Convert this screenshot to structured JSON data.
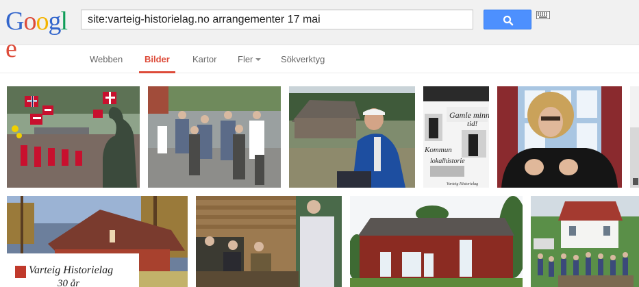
{
  "logo": {
    "letters": [
      "G",
      "o",
      "o",
      "g",
      "l",
      "e"
    ],
    "colors": [
      "#3366cc",
      "#dd4b39",
      "#f4b400",
      "#3366cc",
      "#0f9d58",
      "#dd4b39"
    ]
  },
  "search": {
    "query": "site:varteig-historielag.no arrangementer 17 mai",
    "camera_icon": "camera-icon",
    "keyboard_icon": "keyboard-icon",
    "button_icon": "search-icon",
    "button_color": "#4d90fe"
  },
  "nav": {
    "tabs": [
      {
        "label": "Webben",
        "active": false
      },
      {
        "label": "Bilder",
        "active": true
      },
      {
        "label": "Kartor",
        "active": false
      },
      {
        "label": "Fler",
        "active": false,
        "dropdown": true
      },
      {
        "label": "Sökverktyg",
        "active": false
      }
    ],
    "active_color": "#dd4b39"
  },
  "results": [
    {
      "subject": "17 mai parade with Norwegian flags and statue"
    },
    {
      "subject": "crowd walking on road"
    },
    {
      "subject": "old man in blue jacket near log cabin"
    },
    {
      "subject": "collage poster with text"
    },
    {
      "subject": "man with curly wig in front of window"
    },
    {
      "subject": "red house with autumn trees",
      "caption": [
        "Varteig Historielag",
        "30 år"
      ]
    },
    {
      "subject": "men in log cabin room"
    },
    {
      "subject": "red barn with white doors"
    },
    {
      "subject": "white house with group of people"
    }
  ],
  "poster_text": [
    "Gamle minner",
    "tid!",
    "Kommun",
    "lokalhistorie",
    "Varteig Historielag"
  ]
}
